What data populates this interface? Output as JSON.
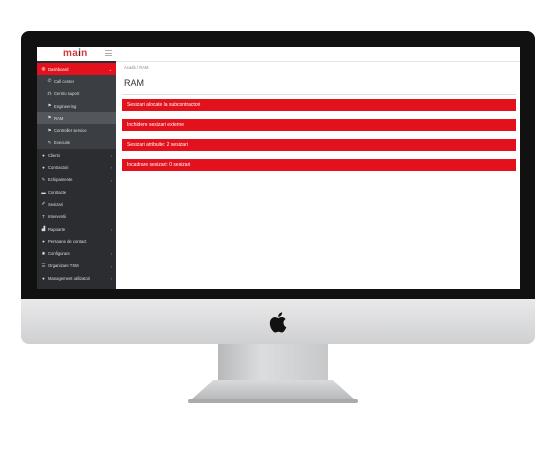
{
  "logo": {
    "text_a": "m",
    "text_b": "a",
    "text_c": "i",
    "text_d": "n"
  },
  "sidebar": {
    "items": [
      {
        "label": "Dashboard",
        "icon": "gauge-icon"
      },
      {
        "label": "Call center",
        "icon": "phone-icon"
      },
      {
        "label": "Centru suport",
        "icon": "headset-icon"
      },
      {
        "label": "Engineering",
        "icon": "flag-icon"
      },
      {
        "label": "RAM",
        "icon": "flag-icon"
      },
      {
        "label": "Controller service",
        "icon": "flag-icon"
      },
      {
        "label": "Executie",
        "icon": "wrench-icon"
      },
      {
        "label": "Clienti",
        "icon": "user-icon"
      },
      {
        "label": "Contractori",
        "icon": "user-icon"
      },
      {
        "label": "Echipamente",
        "icon": "wrench-icon"
      },
      {
        "label": "Contracte",
        "icon": "folder-icon"
      },
      {
        "label": "Sesizari",
        "icon": "pencil-icon"
      },
      {
        "label": "Interventii",
        "icon": "hammer-icon"
      },
      {
        "label": "Rapoarte",
        "icon": "chart-icon"
      },
      {
        "label": "Persoane de contact",
        "icon": "users-icon"
      },
      {
        "label": "Configurare",
        "icon": "gear-icon"
      },
      {
        "label": "Organizare TSM",
        "icon": "list-icon"
      },
      {
        "label": "Management utilizatori",
        "icon": "users-icon"
      }
    ]
  },
  "main": {
    "breadcrumb": "Acasă / RAM",
    "title": "RAM",
    "panels": [
      {
        "label": "Sesizari alocate la subcontractori"
      },
      {
        "label": "Inchidere sesizari externe"
      },
      {
        "label": "Sesizari atribuite: 2 sesizari"
      },
      {
        "label": "Incadrare sesizari: 0 sesizari"
      }
    ]
  },
  "colors": {
    "accent": "#e3111c",
    "sidebar_bg": "#2b2d31",
    "logo": "#d9353b"
  }
}
